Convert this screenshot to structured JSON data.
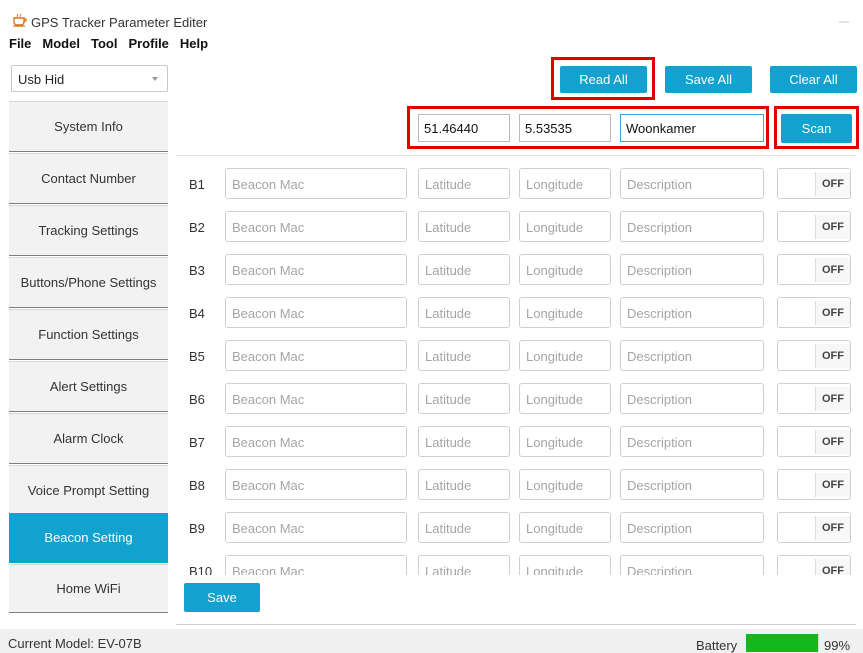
{
  "window": {
    "title": "GPS Tracker Parameter Editer"
  },
  "menu": [
    "File",
    "Model",
    "Tool",
    "Profile",
    "Help"
  ],
  "device": {
    "selected": "Usb Hid"
  },
  "toolbar": {
    "read_all": "Read All",
    "save_all": "Save All",
    "clear_all": "Clear All"
  },
  "sidebar": {
    "items": [
      {
        "label": "System Info"
      },
      {
        "label": "Contact Number"
      },
      {
        "label": "Tracking Settings"
      },
      {
        "label": "Buttons/Phone Settings"
      },
      {
        "label": "Function Settings"
      },
      {
        "label": "Alert Settings"
      },
      {
        "label": "Alarm Clock"
      },
      {
        "label": "Voice Prompt Setting"
      },
      {
        "label": "Beacon Setting",
        "active": true
      },
      {
        "label": "Home WiFi"
      }
    ]
  },
  "scan": {
    "latitude": "51.46440",
    "longitude": "5.53535",
    "description": "Woonkamer",
    "button": "Scan"
  },
  "beacon_placeholders": {
    "mac": "Beacon Mac",
    "latitude": "Latitude",
    "longitude": "Longitude",
    "description": "Description"
  },
  "toggle_off": "OFF",
  "beacons": [
    {
      "id": "B1"
    },
    {
      "id": "B2"
    },
    {
      "id": "B3"
    },
    {
      "id": "B4"
    },
    {
      "id": "B5"
    },
    {
      "id": "B6"
    },
    {
      "id": "B7"
    },
    {
      "id": "B8"
    },
    {
      "id": "B9"
    },
    {
      "id": "B10"
    }
  ],
  "save_label": "Save",
  "status": {
    "model": "Current Model: EV-07B",
    "battery_label": "Battery",
    "battery_percent": "99%",
    "battery_level": 0.99
  },
  "colors": {
    "accent": "#11a2cf",
    "highlight": "#e30000",
    "battery": "#12b81e"
  }
}
